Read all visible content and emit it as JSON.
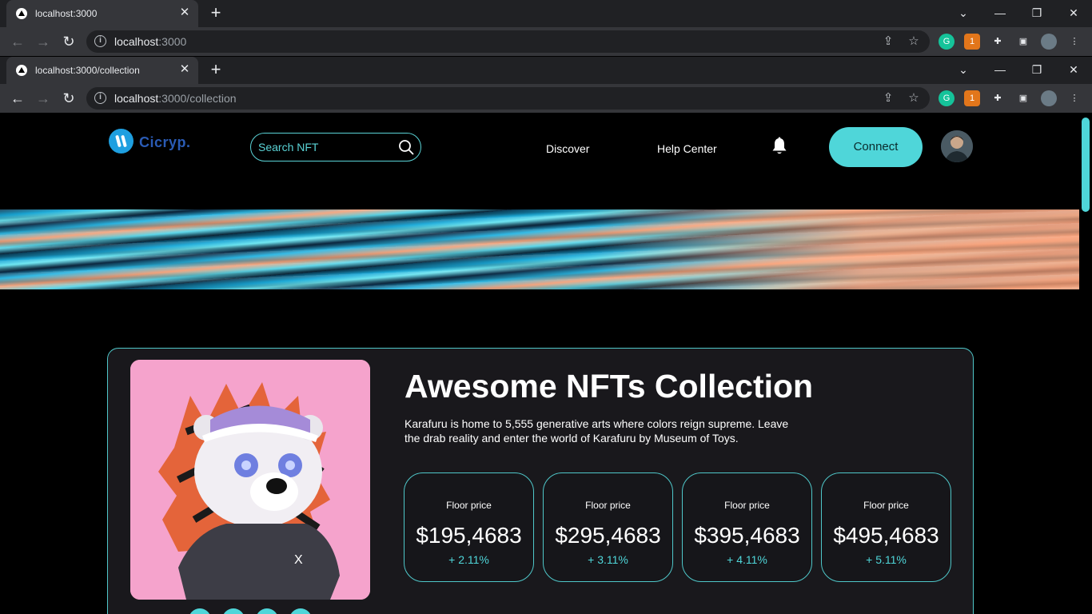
{
  "browser": {
    "window1": {
      "tab_title": "localhost:3000",
      "url_host": "localhost",
      "url_rest": ":3000"
    },
    "window2": {
      "tab_title": "localhost:3000/collection",
      "url_host": "localhost",
      "url_rest": ":3000/collection"
    },
    "extension_badge": "1"
  },
  "header": {
    "logo_text": "Cicryp.",
    "search_placeholder": "Search NFT",
    "nav": [
      "Discover",
      "Help Center"
    ],
    "connect_label": "Connect"
  },
  "collection": {
    "title": "Awesome NFTs Collection",
    "description": "Karafuru is home to 5,555 generative arts where colors reign supreme. Leave the drab reality and enter the world of Karafuru by Museum of Toys.",
    "stats": [
      {
        "label": "Floor price",
        "value": "$195,4683",
        "change": "+ 2.11%"
      },
      {
        "label": "Floor price",
        "value": "$295,4683",
        "change": "+ 3.11%"
      },
      {
        "label": "Floor price",
        "value": "$395,4683",
        "change": "+ 4.11%"
      },
      {
        "label": "Floor price",
        "value": "$495,4683",
        "change": "+ 5.11%"
      }
    ]
  },
  "colors": {
    "accent": "#4fd6d9",
    "background": "#000000",
    "card": "#19181c"
  }
}
